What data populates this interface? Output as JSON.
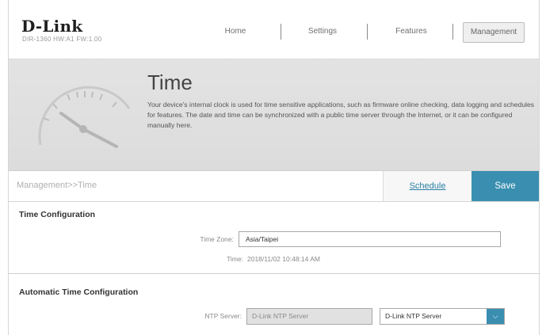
{
  "brand": {
    "logo": "D-Link",
    "model": "DIR-1360 HW:A1 FW:1.00"
  },
  "nav": {
    "items": [
      "Home",
      "Settings",
      "Features",
      "Management"
    ],
    "active": "Management"
  },
  "hero": {
    "title": "Time",
    "description": "Your device's internal clock is used for time sensitive applications, such as firmware online checking, data logging and schedules for features. The date and time can be synchronized with a public time server through the Internet, or it can be configured manually here."
  },
  "subbar": {
    "breadcrumb": "Management>>Time",
    "schedule_label": "Schedule",
    "save_label": "Save"
  },
  "time_config": {
    "title": "Time Configuration",
    "timezone_label": "Time Zone:",
    "timezone_value": "Asia/Taipei",
    "time_label": "Time:",
    "time_value": "2018/11/02 10:48:14 AM"
  },
  "auto_time": {
    "title": "Automatic Time Configuration",
    "ntp_label": "NTP Server:",
    "ntp_value": "D-Link NTP Server",
    "ntp_select": "D-Link NTP Server"
  },
  "colors": {
    "accent": "#3a8fb0",
    "link": "#2a7fa4"
  },
  "icons": {
    "clock": "clock-icon",
    "dropdown": "chevron-down-icon"
  }
}
